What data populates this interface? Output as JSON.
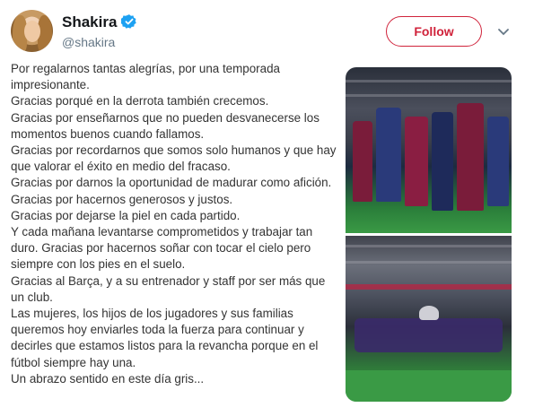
{
  "profile": {
    "name": "Shakira",
    "handle": "@shakira",
    "verified_color": "#1da1f2"
  },
  "follow_label": "Follow",
  "accent_color": "#d0233b",
  "note_text": "Por regalarnos tantas alegrías, por una temporada impresionante.\nGracias porqué en la derrota también crecemos.\nGracias por enseñarnos que no pueden desvanecerse los momentos buenos cuando fallamos.\nGracias por recordarnos que somos solo humanos y que hay que valorar el éxito en medio del fracaso.\nGracias por darnos la oportunidad de madurar como afición.\nGracias por hacernos generosos y justos.\nGracias por dejarse la piel en cada partido.\nY cada mañana levantarse comprometidos  y trabajar tan duro. Gracias por  hacernos soñar con tocar el cielo pero siempre con los pies en el suelo.\nGracias al Barça, y a su entrenador y staff por ser más que un club.\nLas mujeres, los hijos de los jugadores y sus familias queremos hoy enviarles toda la fuerza para continuar y decirles que  estamos listos para la revancha porque en el fútbol siempre hay una.\nUn abrazo sentido en este día gris...",
  "icons": {
    "verified": "verified-badge-icon",
    "caret": "chevron-down-icon"
  }
}
